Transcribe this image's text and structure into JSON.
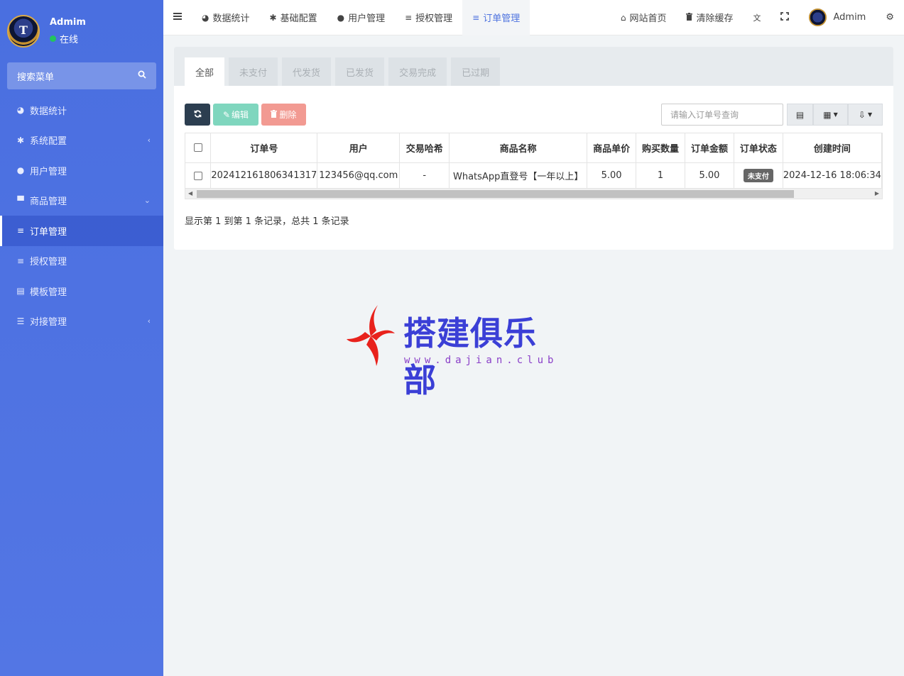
{
  "sidebar": {
    "user_name": "Admim",
    "avatar_text": "T",
    "status": "在线",
    "search_label": "搜索菜单",
    "items": [
      {
        "label": "数据统计",
        "icon": "dashboard-icon",
        "glyph": "◕",
        "arrow": ""
      },
      {
        "label": "系统配置",
        "icon": "gear-icon",
        "glyph": "✱",
        "arrow": "‹"
      },
      {
        "label": "用户管理",
        "icon": "user-icon",
        "glyph": "●",
        "arrow": ""
      },
      {
        "label": "商品管理",
        "icon": "cart-icon",
        "glyph": "▀",
        "arrow": "⌄"
      },
      {
        "label": "订单管理",
        "icon": "list-icon",
        "glyph": "≡",
        "arrow": ""
      },
      {
        "label": "授权管理",
        "icon": "list-icon",
        "glyph": "≡",
        "arrow": ""
      },
      {
        "label": "模板管理",
        "icon": "template-icon",
        "glyph": "▤",
        "arrow": ""
      },
      {
        "label": "对接管理",
        "icon": "sliders-icon",
        "glyph": "☰",
        "arrow": "‹"
      }
    ]
  },
  "topbar": {
    "tabs": [
      {
        "label": "数据统计",
        "icon": "dashboard-icon",
        "glyph": "◕"
      },
      {
        "label": "基础配置",
        "icon": "gear-icon",
        "glyph": "✱"
      },
      {
        "label": "用户管理",
        "icon": "user-icon",
        "glyph": "●"
      },
      {
        "label": "授权管理",
        "icon": "list-icon",
        "glyph": "≡"
      },
      {
        "label": "订单管理",
        "icon": "list-icon",
        "glyph": "≡"
      }
    ],
    "home_label": "网站首页",
    "clear_cache_label": "清除缓存",
    "user_name": "Admim"
  },
  "panel": {
    "tabs": [
      "全部",
      "未支付",
      "代发货",
      "已发货",
      "交易完成",
      "已过期"
    ],
    "edit_label": "编辑",
    "delete_label": "删除",
    "search_placeholder": "请输入订单号查询",
    "columns": [
      "订单号",
      "用户",
      "交易哈希",
      "商品名称",
      "商品单价",
      "购买数量",
      "订单金额",
      "订单状态",
      "创建时间"
    ],
    "rows": [
      {
        "order_no": "202412161806341317",
        "user": "123456@qq.com",
        "tx_hash": "-",
        "product": "WhatsApp直登号【一年以上】",
        "unit_price": "5.00",
        "quantity": "1",
        "amount": "5.00",
        "status": "未支付",
        "created_at": "2024-12-16 18:06:34"
      }
    ],
    "page_info": "显示第 1 到第 1 条记录，总共 1 条记录"
  },
  "watermark": {
    "title": "搭建俱乐部",
    "url": "www.dajian.club"
  },
  "colors": {
    "sidebar": "#4e73df",
    "accent": "#4e73df",
    "refresh": "#2c3e50",
    "edit": "#7fd6be",
    "delete": "#f29a92"
  }
}
